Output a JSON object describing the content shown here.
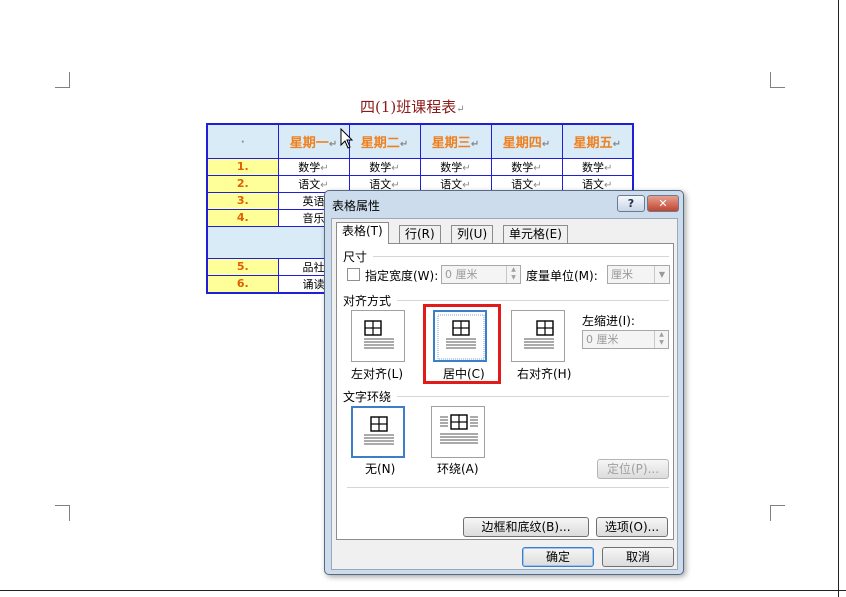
{
  "document": {
    "title": "四(1)班课程表",
    "paragraph_mark": "↵",
    "cell_mark": "·",
    "table": {
      "header": [
        "",
        "星期一",
        "星期二",
        "星期三",
        "星期四",
        "星期五"
      ],
      "rows": [
        {
          "num": "1.",
          "cells": [
            "数学",
            "数学",
            "数学",
            "数学",
            "数学"
          ]
        },
        {
          "num": "2.",
          "cells": [
            "语文",
            "语文",
            "语文",
            "语文",
            "语文"
          ]
        },
        {
          "num": "3.",
          "cells": [
            "英语"
          ]
        },
        {
          "num": "4.",
          "cells": [
            "音乐"
          ]
        },
        {
          "num": "5.",
          "cells": [
            "品社"
          ]
        },
        {
          "num": "6.",
          "cells": [
            "诵读"
          ]
        }
      ]
    }
  },
  "dialog": {
    "title": "表格属性",
    "help_label": "?",
    "close_label": "✕",
    "tabs": [
      "表格(T)",
      "行(R)",
      "列(U)",
      "单元格(E)"
    ],
    "size": {
      "section_label": "尺寸",
      "preferred_width_label": "指定宽度(W):",
      "preferred_width_value": "0 厘米",
      "measure_label": "度量单位(M):",
      "measure_value": "厘米"
    },
    "alignment": {
      "section_label": "对齐方式",
      "options": [
        "左对齐(L)",
        "居中(C)",
        "右对齐(H)"
      ],
      "selected": "居中(C)",
      "indent_label": "左缩进(I):",
      "indent_value": "0 厘米"
    },
    "wrapping": {
      "section_label": "文字环绕",
      "options": [
        "无(N)",
        "环绕(A)"
      ],
      "selected": "无(N)",
      "position_button": "定位(P)..."
    },
    "borders_button": "边框和底纹(B)...",
    "options_button": "选项(O)...",
    "ok_button": "确定",
    "cancel_button": "取消"
  }
}
